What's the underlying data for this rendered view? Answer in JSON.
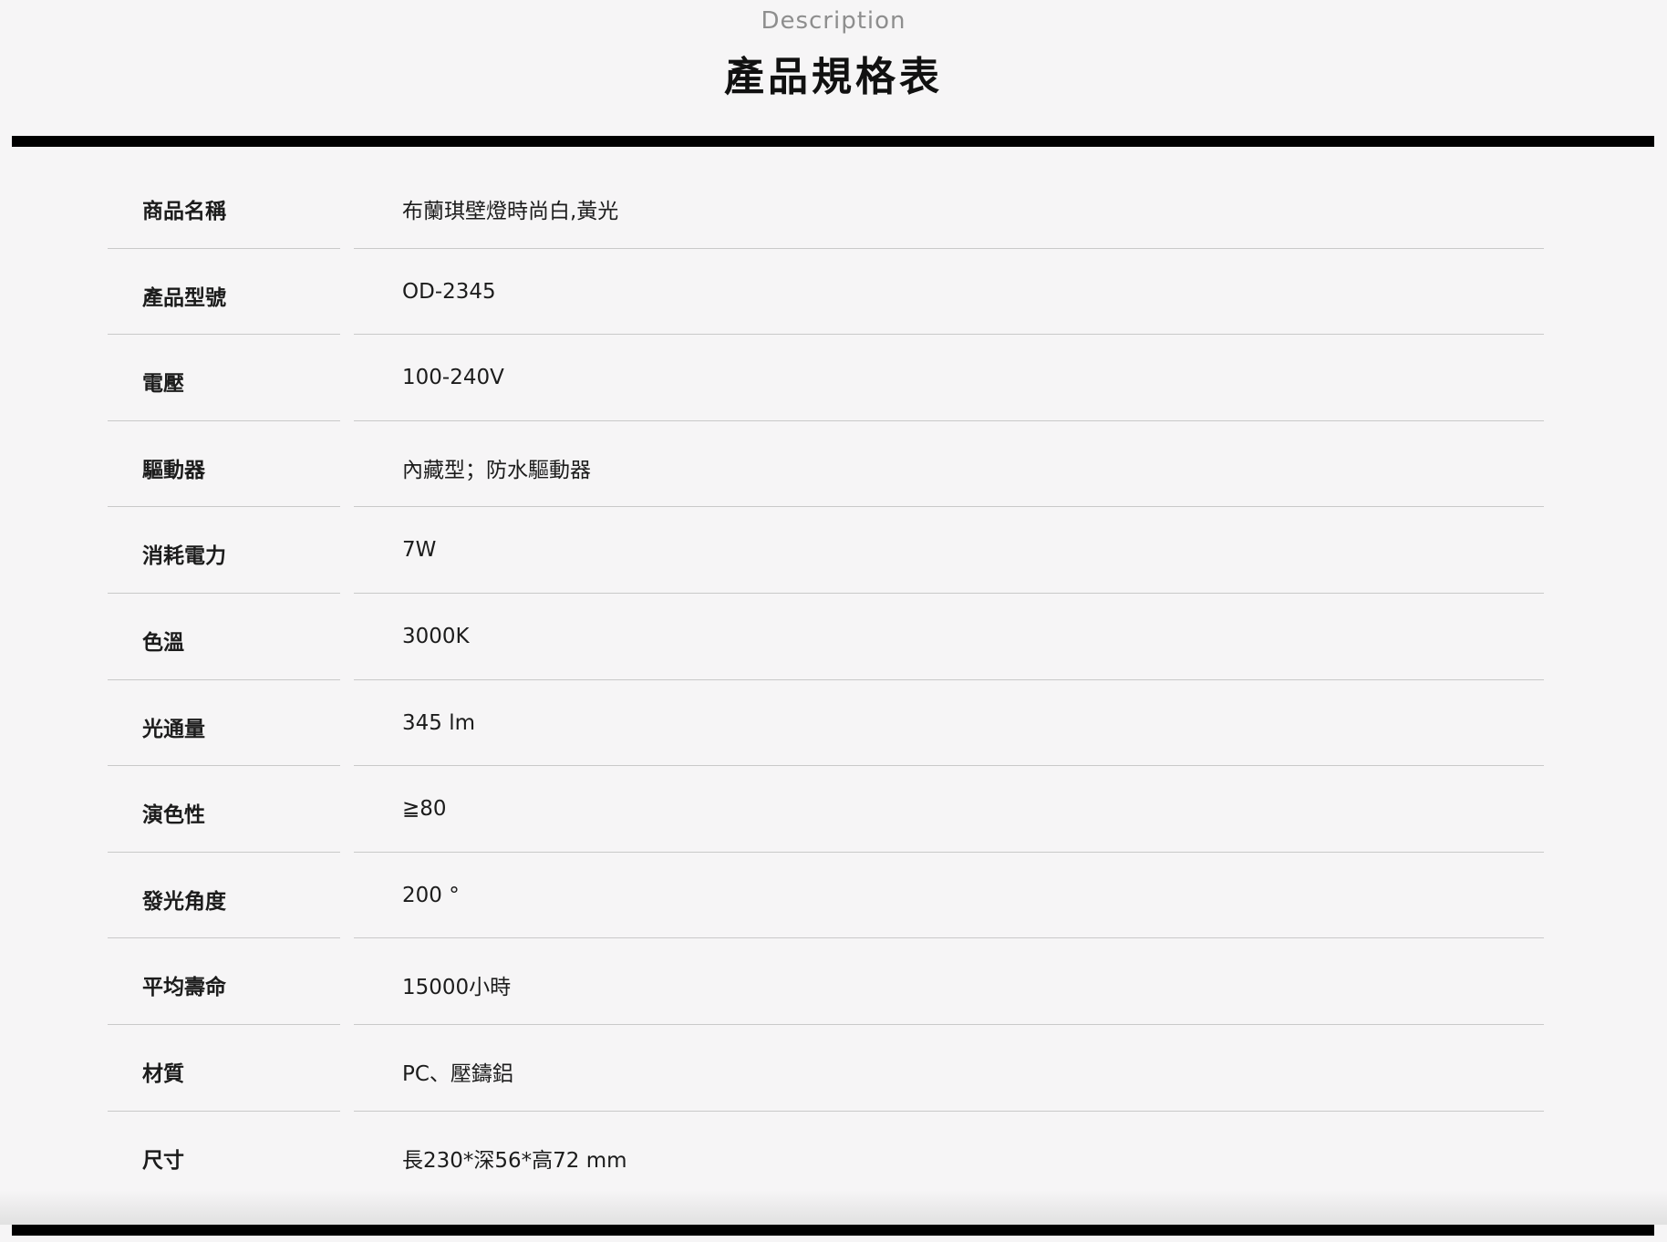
{
  "header": {
    "subtitle": "Description",
    "title": "產品規格表"
  },
  "specs": [
    {
      "label": "商品名稱",
      "value": "布蘭琪壁燈時尚白,黃光"
    },
    {
      "label": "產品型號",
      "value": "OD-2345"
    },
    {
      "label": "電壓",
      "value": "100-240V"
    },
    {
      "label": "驅動器",
      "value": "內藏型；防水驅動器"
    },
    {
      "label": "消耗電力",
      "value": "7W"
    },
    {
      "label": "色溫",
      "value": "3000K"
    },
    {
      "label": "光通量",
      "value": "345 lm"
    },
    {
      "label": "演色性",
      "value": "≧80"
    },
    {
      "label": "發光角度",
      "value": "200 °"
    },
    {
      "label": "平均壽命",
      "value": "15000小時"
    },
    {
      "label": "材質",
      "value": "PC、壓鑄鋁"
    },
    {
      "label": "尺寸",
      "value": "長230*深56*高72 mm"
    }
  ]
}
